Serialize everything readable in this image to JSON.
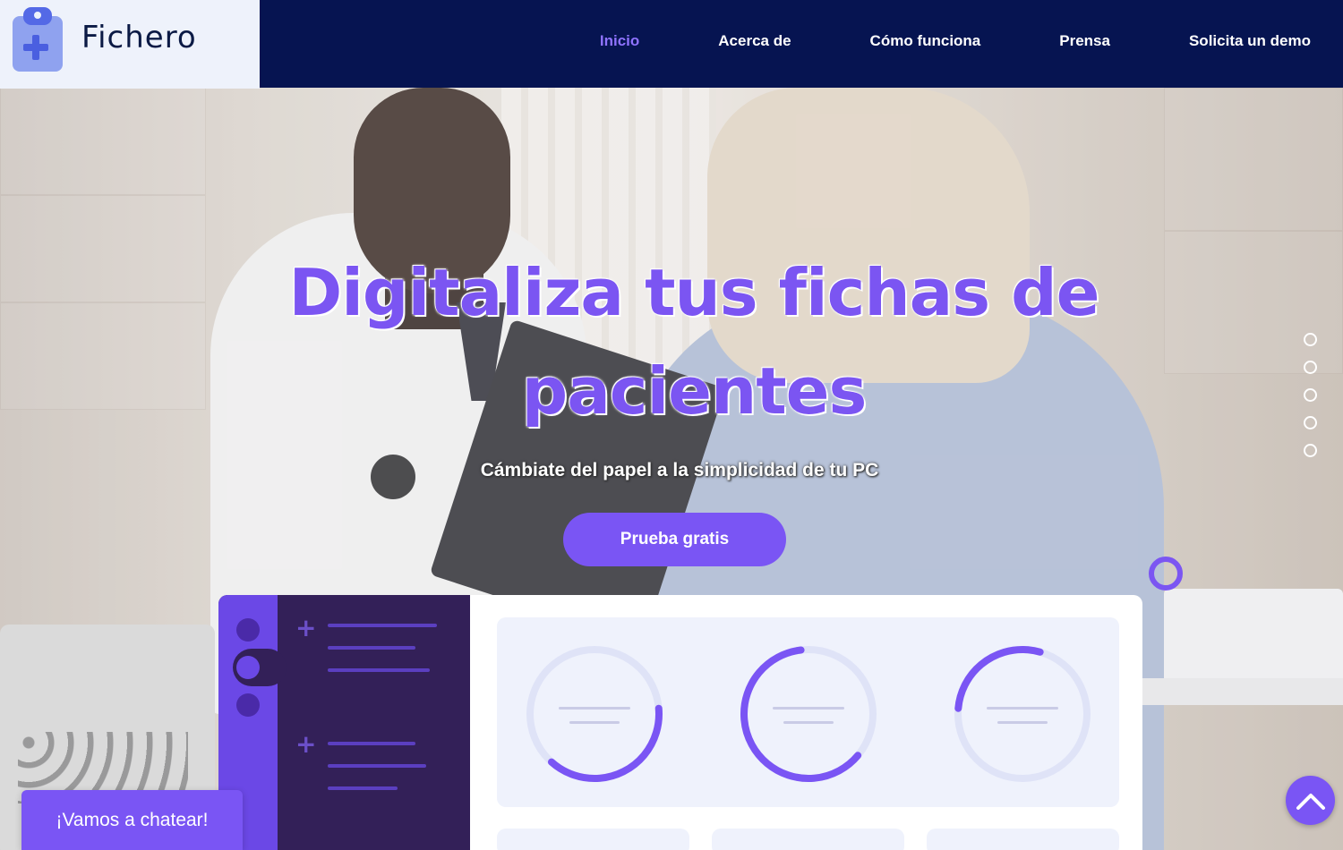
{
  "header": {
    "logo_text": "Fichero",
    "logo_icon": "clipboard-medical-icon",
    "nav": [
      {
        "label": "Inicio",
        "active": true
      },
      {
        "label": "Acerca de",
        "active": false
      },
      {
        "label": "Cómo funciona",
        "active": false
      },
      {
        "label": "Prensa",
        "active": false
      },
      {
        "label": "Solicita un demo",
        "active": false
      }
    ]
  },
  "hero": {
    "headline": "Digitaliza tus fichas de pacientes",
    "subheadline": "Cámbiate del papel a la simplicidad de tu PC",
    "cta_label": "Prueba gratis",
    "slider_dots": 5,
    "background_image": "doctor-with-patient-photo"
  },
  "dashboard_preview": {
    "gauges": [
      {
        "fill_fraction": 0.38
      },
      {
        "fill_fraction": 0.62
      },
      {
        "fill_fraction": 0.28
      }
    ]
  },
  "widgets": {
    "chat_label": "¡Vamos a chatear!",
    "back_to_top_icon": "chevron-up-icon"
  },
  "colors": {
    "navy": "#061451",
    "accent": "#7a55f4",
    "accent_dark": "#332058",
    "panel": "#eff2fc"
  }
}
